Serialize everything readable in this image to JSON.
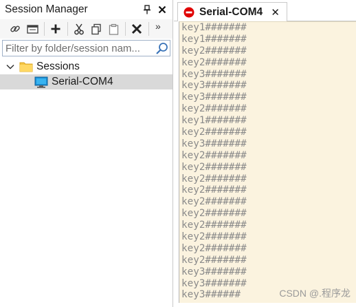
{
  "session_manager": {
    "title": "Session Manager",
    "pin_icon": "pin-icon",
    "close_icon": "close-icon",
    "toolbar": {
      "icons": [
        "link-icon",
        "new-window-icon",
        "add-icon",
        "cut-icon",
        "copy-icon",
        "paste-icon",
        "delete-icon"
      ],
      "more_label": "»"
    },
    "filter": {
      "placeholder": "Filter by folder/session nam...",
      "value": ""
    },
    "tree": {
      "root_label": "Sessions",
      "children": [
        {
          "label": "Serial-COM4"
        }
      ]
    }
  },
  "terminal_tab": {
    "label": "Serial-COM4",
    "close_label": "✕",
    "status_color": "#e00000"
  },
  "terminal": {
    "background": "#fbf3df",
    "lines": [
      "key1#######",
      "key1#######",
      "key2#######",
      "key2#######",
      "key3#######",
      "key3#######",
      "key3#######",
      "key2#######",
      "key1#######",
      "key2#######",
      "key3#######",
      "key2#######",
      "key2#######",
      "key2#######",
      "key2#######",
      "key2#######",
      "key2#######",
      "key2#######",
      "key2#######",
      "key2#######",
      "key2#######",
      "key3#######",
      "key3#######",
      "key3######"
    ]
  },
  "watermark": "CSDN @.程序龙"
}
